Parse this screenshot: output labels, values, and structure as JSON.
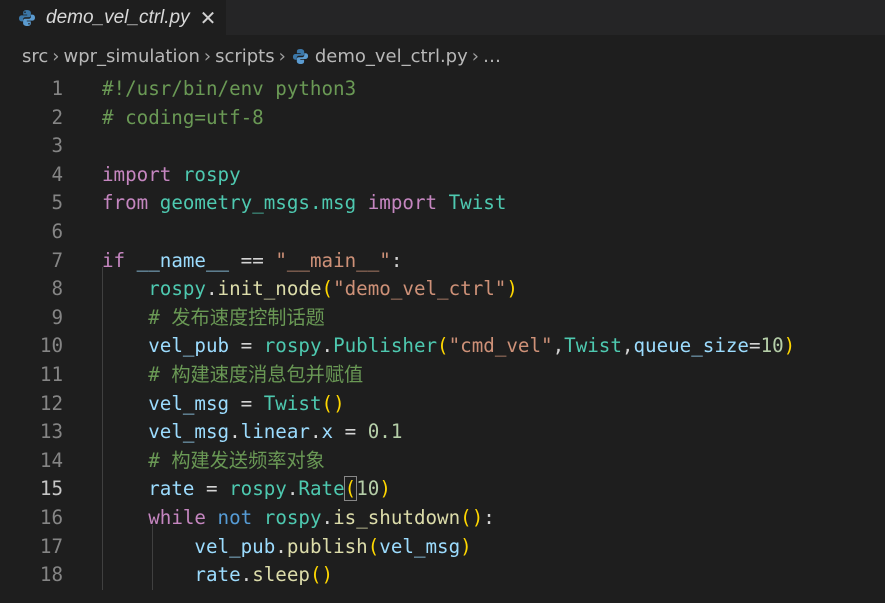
{
  "tab": {
    "title": "demo_vel_ctrl.py",
    "close_glyph": "✕",
    "icon": "python-icon"
  },
  "breadcrumb": {
    "items": [
      "src",
      "wpr_simulation",
      "scripts",
      "demo_vel_ctrl.py",
      "…"
    ],
    "separator": "›"
  },
  "editor": {
    "active_line": 15,
    "line_numbers": [
      "1",
      "2",
      "3",
      "4",
      "5",
      "6",
      "7",
      "8",
      "9",
      "10",
      "11",
      "12",
      "13",
      "14",
      "15",
      "16",
      "17",
      "18"
    ],
    "lines": [
      [
        {
          "t": "#!/usr/bin/env python3",
          "c": "c"
        }
      ],
      [
        {
          "t": "# coding=utf-8",
          "c": "c"
        }
      ],
      [],
      [
        {
          "t": "import",
          "c": "k"
        },
        {
          "t": " ",
          "c": "t"
        },
        {
          "t": "rospy",
          "c": "m"
        }
      ],
      [
        {
          "t": "from",
          "c": "k"
        },
        {
          "t": " ",
          "c": "t"
        },
        {
          "t": "geometry_msgs.msg",
          "c": "m"
        },
        {
          "t": " ",
          "c": "t"
        },
        {
          "t": "import",
          "c": "k"
        },
        {
          "t": " ",
          "c": "t"
        },
        {
          "t": "Twist",
          "c": "m"
        }
      ],
      [],
      [
        {
          "t": "if",
          "c": "k"
        },
        {
          "t": " ",
          "c": "t"
        },
        {
          "t": "__name__",
          "c": "v"
        },
        {
          "t": " == ",
          "c": "t"
        },
        {
          "t": "\"__main__\"",
          "c": "s"
        },
        {
          "t": ":",
          "c": "t"
        }
      ],
      [
        {
          "t": "    ",
          "c": "t"
        },
        {
          "t": "rospy",
          "c": "m"
        },
        {
          "t": ".",
          "c": "t"
        },
        {
          "t": "init_node",
          "c": "f"
        },
        {
          "t": "(",
          "c": "p"
        },
        {
          "t": "\"demo_vel_ctrl\"",
          "c": "s"
        },
        {
          "t": ")",
          "c": "p"
        }
      ],
      [
        {
          "t": "    ",
          "c": "t"
        },
        {
          "t": "# 发布速度控制话题",
          "c": "c"
        }
      ],
      [
        {
          "t": "    ",
          "c": "t"
        },
        {
          "t": "vel_pub",
          "c": "v"
        },
        {
          "t": " = ",
          "c": "t"
        },
        {
          "t": "rospy",
          "c": "m"
        },
        {
          "t": ".",
          "c": "t"
        },
        {
          "t": "Publisher",
          "c": "m"
        },
        {
          "t": "(",
          "c": "p"
        },
        {
          "t": "\"cmd_vel\"",
          "c": "s"
        },
        {
          "t": ",",
          "c": "t"
        },
        {
          "t": "Twist",
          "c": "m"
        },
        {
          "t": ",",
          "c": "t"
        },
        {
          "t": "queue_size",
          "c": "v"
        },
        {
          "t": "=",
          "c": "t"
        },
        {
          "t": "10",
          "c": "n"
        },
        {
          "t": ")",
          "c": "p"
        }
      ],
      [
        {
          "t": "    ",
          "c": "t"
        },
        {
          "t": "# 构建速度消息包并赋值",
          "c": "c"
        }
      ],
      [
        {
          "t": "    ",
          "c": "t"
        },
        {
          "t": "vel_msg",
          "c": "v"
        },
        {
          "t": " = ",
          "c": "t"
        },
        {
          "t": "Twist",
          "c": "m"
        },
        {
          "t": "()",
          "c": "p"
        }
      ],
      [
        {
          "t": "    ",
          "c": "t"
        },
        {
          "t": "vel_msg",
          "c": "v"
        },
        {
          "t": ".",
          "c": "t"
        },
        {
          "t": "linear",
          "c": "v"
        },
        {
          "t": ".",
          "c": "t"
        },
        {
          "t": "x",
          "c": "v"
        },
        {
          "t": " = ",
          "c": "t"
        },
        {
          "t": "0.1",
          "c": "n"
        }
      ],
      [
        {
          "t": "    ",
          "c": "t"
        },
        {
          "t": "# 构建发送频率对象",
          "c": "c"
        }
      ],
      [
        {
          "t": "    ",
          "c": "t"
        },
        {
          "t": "rate",
          "c": "v"
        },
        {
          "t": " = ",
          "c": "t"
        },
        {
          "t": "rospy",
          "c": "m"
        },
        {
          "t": ".",
          "c": "t"
        },
        {
          "t": "Rate",
          "c": "m"
        },
        {
          "t": "(",
          "c": "p bm"
        },
        {
          "t": "10",
          "c": "n"
        },
        {
          "t": ")",
          "c": "p"
        }
      ],
      [
        {
          "t": "    ",
          "c": "t"
        },
        {
          "t": "while",
          "c": "k"
        },
        {
          "t": " ",
          "c": "t"
        },
        {
          "t": "not",
          "c": "kb"
        },
        {
          "t": " ",
          "c": "t"
        },
        {
          "t": "rospy",
          "c": "m"
        },
        {
          "t": ".",
          "c": "t"
        },
        {
          "t": "is_shutdown",
          "c": "f"
        },
        {
          "t": "()",
          "c": "p"
        },
        {
          "t": ":",
          "c": "t"
        }
      ],
      [
        {
          "t": "        ",
          "c": "t"
        },
        {
          "t": "vel_pub",
          "c": "v"
        },
        {
          "t": ".",
          "c": "t"
        },
        {
          "t": "publish",
          "c": "f"
        },
        {
          "t": "(",
          "c": "p"
        },
        {
          "t": "vel_msg",
          "c": "v"
        },
        {
          "t": ")",
          "c": "p"
        }
      ],
      [
        {
          "t": "        ",
          "c": "t"
        },
        {
          "t": "rate",
          "c": "v"
        },
        {
          "t": ".",
          "c": "t"
        },
        {
          "t": "sleep",
          "c": "f"
        },
        {
          "t": "()",
          "c": "p"
        }
      ]
    ]
  },
  "colors": {
    "background": "#1e1e1e",
    "comment": "#6a9955",
    "keyword": "#c586c0",
    "string": "#ce9178",
    "variable": "#9cdcfe",
    "module": "#4ec9b0",
    "function": "#dcdcaa",
    "number": "#b5cea8",
    "bracket": "#ffd700"
  }
}
